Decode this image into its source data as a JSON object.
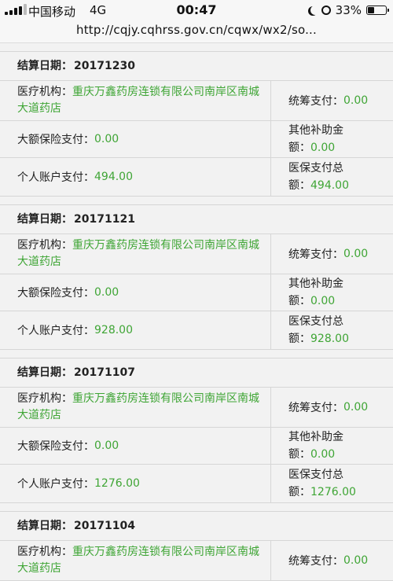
{
  "status_bar": {
    "carrier": "中国移动",
    "network": "4G",
    "time": "00:47",
    "battery": "33%",
    "battery_level": 0.33
  },
  "url_bar": {
    "url": "http://cqjy.cqhrss.gov.cn/cqwx/wx2/so..."
  },
  "labels": {
    "date": "结算日期：",
    "institution": "医疗机构：",
    "pooled": "统筹支付：",
    "large_insurance": "大额保险支付：",
    "other_subsidy_line1": "其他补助金",
    "other_subsidy_line2": "额：",
    "personal": "个人账户支付：",
    "total_line1": "医保支付总",
    "total_line2": "额："
  },
  "records": [
    {
      "date": "20171230",
      "institution": "重庆万鑫药房连锁有限公司南岸区南城大道药店",
      "pooled": "0.00",
      "large_insurance": "0.00",
      "other_subsidy": "0.00",
      "personal": "494.00",
      "total": "494.00"
    },
    {
      "date": "20171121",
      "institution": "重庆万鑫药房连锁有限公司南岸区南城大道药店",
      "pooled": "0.00",
      "large_insurance": "0.00",
      "other_subsidy": "0.00",
      "personal": "928.00",
      "total": "928.00"
    },
    {
      "date": "20171107",
      "institution": "重庆万鑫药房连锁有限公司南岸区南城大道药店",
      "pooled": "0.00",
      "large_insurance": "0.00",
      "other_subsidy": "0.00",
      "personal": "1276.00",
      "total": "1276.00"
    },
    {
      "date": "20171104",
      "institution": "重庆万鑫药房连锁有限公司南岸区南城大道药店",
      "pooled": "0.00"
    }
  ]
}
